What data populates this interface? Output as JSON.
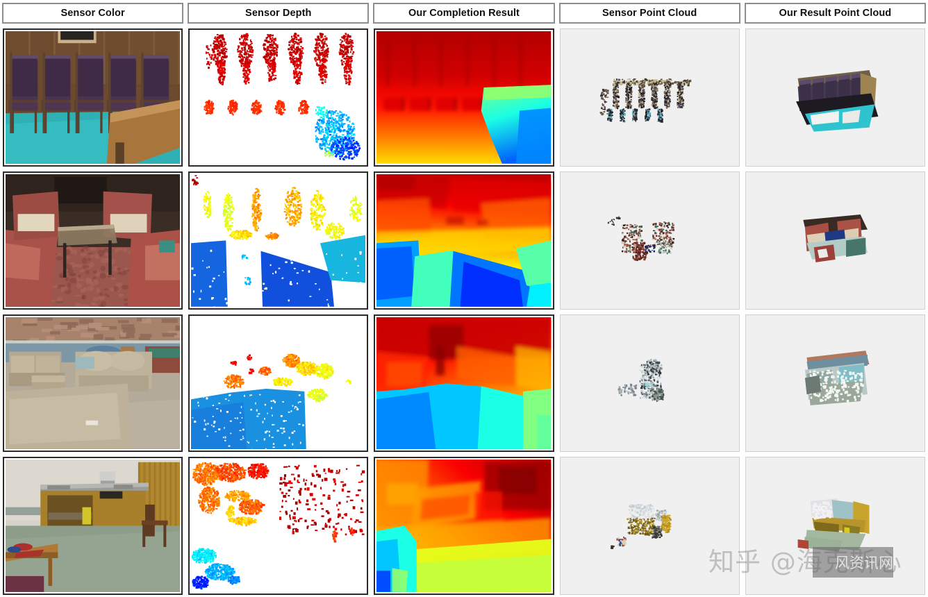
{
  "figure": {
    "type": "qualitative-results-table",
    "rows": 4,
    "columns": 5,
    "background_color": "#ffffff",
    "header_border_color": "#8d8d8d",
    "image_border_color": "#2b2b2b",
    "pointcloud_background_color": "#f0f0f0"
  },
  "header": {
    "columns": [
      {
        "label": "Sensor Color",
        "key": "sensor_color"
      },
      {
        "label": "Sensor Depth",
        "key": "sensor_depth"
      },
      {
        "label": "Our Completion Result",
        "key": "completion_result"
      },
      {
        "label": "Sensor Point Cloud",
        "key": "sensor_point_cloud"
      },
      {
        "label": "Our Result Point Cloud",
        "key": "result_point_cloud"
      }
    ]
  },
  "rows": [
    {
      "id": "row-1",
      "scene": "lecture hall with row of purple chairs and wooden table",
      "sensor_color": {
        "description": "Indoor hall: five dark purple upholstered chairs in a row against wood panelling, teal carpet floor, wooden table edge at right",
        "palette": {
          "chair": "#4a3550",
          "wood": "#6b4a2f",
          "floor": "#2fb7b7",
          "wall": "#7a5c3e",
          "table": "#a8753c"
        }
      },
      "sensor_depth": {
        "description": "Sparse depth points: red vertical streaks across top for chair backs, orange blobs lower, cyan/blue cluster bottom right",
        "background": "#ffffff",
        "dominant_colors": [
          "#e01b0c",
          "#f05a10",
          "#19b6e8",
          "#1060e0"
        ],
        "density": "sparse"
      },
      "completion_result": {
        "description": "Dense jet-colormap depth: red upper wall, orange mid chairs, yellow floor gradient, cyan-to-blue table wedge at right",
        "colormap": "jet",
        "near_color": "#0000ff",
        "far_color": "#d40000"
      },
      "sensor_point_cloud": {
        "description": "Sparse colored 3D points forming broken chair silhouettes, dark brown and beige",
        "background": "#f0f0f0",
        "density": "sparse"
      },
      "result_point_cloud": {
        "description": "Dense reconstructed 3D surface of purple chair row with teal floor plane",
        "background": "#f0f0f0",
        "density": "dense"
      }
    },
    {
      "id": "row-2",
      "scene": "lounge with red armchairs and coffee table",
      "sensor_color": {
        "description": "Lounge: four red/maroon patterned armchairs facing each other around a glass coffee table, patterned carpet",
        "palette": {
          "chair": "#a8514a",
          "carpet": "#9d5b52",
          "table": "#8c7a63",
          "wall": "#3a2e28",
          "seat": "#d8cfbc"
        }
      },
      "sensor_depth": {
        "description": "Sparse depth: yellow-green chair outlines upper half, large solid blue floor regions lower, cyan patch right",
        "background": "#ffffff",
        "dominant_colors": [
          "#e8e020",
          "#8fd82a",
          "#1060e0",
          "#18c8d8"
        ],
        "density": "medium"
      },
      "completion_result": {
        "description": "Dense jet depth: orange-red ceiling and back wall, yellow mid band, large blue and cyan floor/furniture wedges",
        "colormap": "jet",
        "near_color": "#0000ff",
        "far_color": "#d40000"
      },
      "sensor_point_cloud": {
        "description": "Sparse points showing fragmented red chair shapes and dark table",
        "background": "#f0f0f0",
        "density": "sparse"
      },
      "result_point_cloud": {
        "description": "Dense reconstruction of four red armchairs around table seen from above",
        "background": "#f0f0f0",
        "density": "dense"
      }
    },
    {
      "id": "row-3",
      "scene": "basement living room with beige sofas and stone wall",
      "sensor_color": {
        "description": "Living room: beige microfiber sofa, loveseat and ottoman, stone veneer wall top, blue-gray painted wall, tile floor, pool table at right",
        "palette": {
          "sofa": "#b9ad94",
          "wall_stone": "#b08b72",
          "wall_paint": "#7e99a6",
          "floor": "#b5ad9c"
        }
      },
      "sensor_depth": {
        "description": "Sparse depth: scattered orange/yellow/green points in upper middle, large solid blue region across lower left",
        "background": "#ffffff",
        "dominant_colors": [
          "#f08a14",
          "#d8e020",
          "#6fd060",
          "#1a8fe0"
        ],
        "density": "medium"
      },
      "completion_result": {
        "description": "Dense jet depth: red-orange upper wall with dark red recess, orange middle, large blue sofa region lower left, cyan-green right",
        "colormap": "jet",
        "near_color": "#0000ff",
        "far_color": "#d40000"
      },
      "sensor_point_cloud": {
        "description": "Sparse white-gray points forming partial sofa and wall fragments",
        "background": "#f0f0f0",
        "density": "sparse"
      },
      "result_point_cloud": {
        "description": "Dense reconstruction: stone wall strip on top, beige sofas and cyan floor below",
        "background": "#f0f0f0",
        "density": "dense"
      }
    },
    {
      "id": "row-4",
      "scene": "kitchenette with stainless steel counter and wooden cabinets",
      "sensor_color": {
        "description": "Kitchenette: long stainless steel sink counter with wooden cabinets, yellow bin underneath, wooden chair at right, low table with red objects front left",
        "palette": {
          "counter": "#9a9a98",
          "cabinet": "#b08c3e",
          "wall": "#d8d4cc",
          "floor": "#8a9a86",
          "bin": "#d8c82a"
        }
      },
      "sensor_depth": {
        "description": "Sparse depth: dense yellow-orange points upper left and top, green rectangle outline centre, cyan-blue cluster bottom left, red dots scattered upper right",
        "background": "#ffffff",
        "dominant_colors": [
          "#f0c818",
          "#f07018",
          "#8fd030",
          "#18a8e0",
          "#1030c0"
        ],
        "density": "medium"
      },
      "completion_result": {
        "description": "Dense jet depth: yellow-green left, orange counter block centre, dark red right recess, cyan blue bottom left corner, green floor bottom",
        "colormap": "jet",
        "near_color": "#0000ff",
        "far_color": "#d40000"
      },
      "sensor_point_cloud": {
        "description": "Sparse pale points outlining counter edge, yellow cabinet fragments, small red object lower left",
        "background": "#f0f0f0",
        "density": "sparse"
      },
      "result_point_cloud": {
        "description": "Dense reconstruction of kitchen counter with golden cabinets, pale wall and green floor plane",
        "background": "#f0f0f0",
        "density": "dense"
      }
    }
  ],
  "watermark": {
    "text": "知乎 @海克斯心",
    "logo_text": "风资讯网",
    "color": "rgba(125,125,125,0.42)"
  }
}
